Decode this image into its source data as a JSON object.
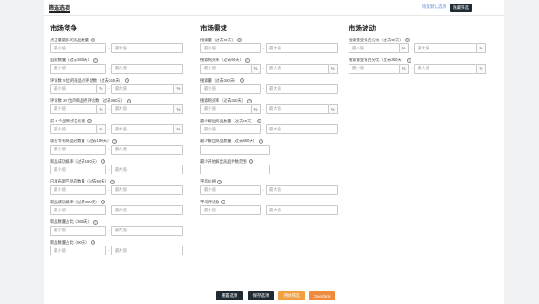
{
  "header": {
    "title": "筛选选项",
    "link": "恢复默认选项",
    "hide_button": "隐藏筛选"
  },
  "placeholders": {
    "min": "最小值",
    "max": "最大值"
  },
  "columns": {
    "competition": {
      "title": "市场竞争",
      "fields": [
        {
          "label": "点击量最多的商品数量"
        },
        {
          "label": "追踪数量（过去360天）"
        },
        {
          "label": "评论数 5 位的商品点评总数（过去360天）"
        },
        {
          "label": "评论数 20 位的商品点评总数（过去360天）"
        },
        {
          "label": "前 3 个品牌点击份额"
        },
        {
          "label": "现在专有商品的数量（过去180天）"
        },
        {
          "label": "新品成功概率（过去180天）"
        },
        {
          "label": "已发布新产品的数量（过去90天）"
        },
        {
          "label": "新品成功概率（过去360天）"
        },
        {
          "label": "新品数量占比（360天）"
        },
        {
          "label": "新品数量占比（90天）"
        }
      ]
    },
    "demand": {
      "title": "市场需求",
      "fields": [
        {
          "label": "搜索量（过去90天）"
        },
        {
          "label": "搜索购买率（过去90天）"
        },
        {
          "label": "搜索量（过去360天）"
        },
        {
          "label": "搜索购买率（过去360天）"
        },
        {
          "label": "最少解出商品数量（过去90天）"
        },
        {
          "label": "最少解出商品数量（过去360天）"
        },
        {
          "label": "最少开始解出商品件数范围"
        },
        {
          "label": "平均价格"
        },
        {
          "label": "平均评论数"
        }
      ]
    },
    "trend": {
      "title": "市场波动",
      "fields": [
        {
          "label": "搜索量变化百分比（过去90天）"
        },
        {
          "label": "搜索量变化百分比（过去360天）"
        }
      ]
    }
  },
  "footer": {
    "reset": "重置选项",
    "save": "保存选项",
    "start": "开始筛选",
    "onequick": "OneClick"
  },
  "colors": {
    "dark": "#1f2b33",
    "orange": "#f0a040",
    "accent": "#f08a3c"
  }
}
